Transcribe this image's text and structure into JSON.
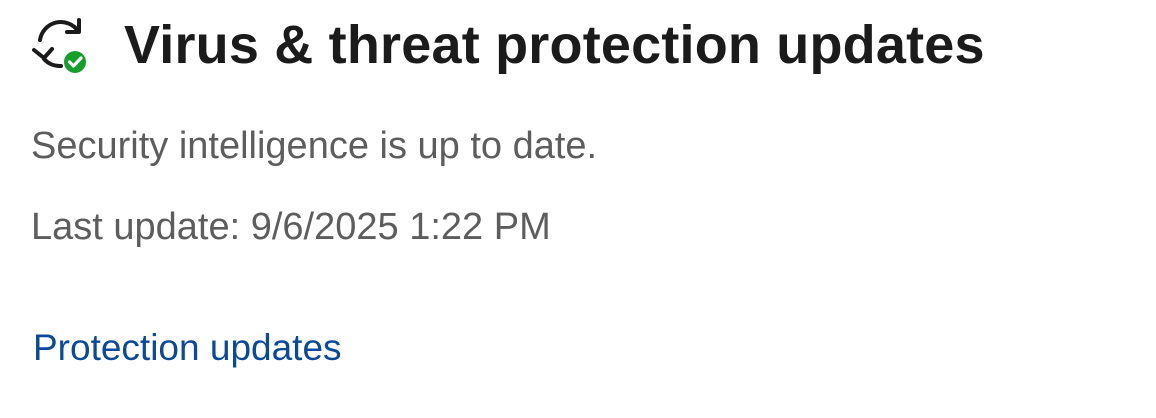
{
  "section": {
    "icon": "refresh-check-icon",
    "title": "Virus & threat protection updates",
    "status_text": "Security intelligence is up to date.",
    "last_update_text": "Last update: 9/6/2025 1:22 PM",
    "link_label": "Protection updates"
  },
  "colors": {
    "title": "#1b1b1b",
    "body_text": "#5d5d5d",
    "link": "#0b4a9a",
    "status_ok": "#16a02b"
  }
}
